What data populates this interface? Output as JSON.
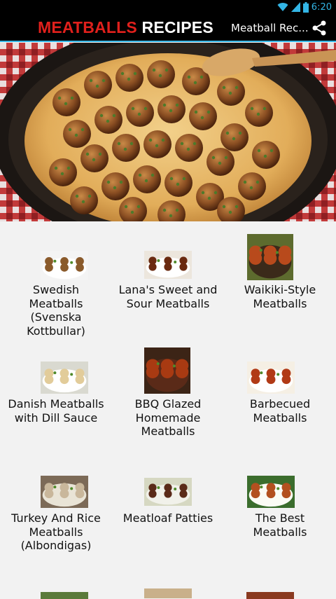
{
  "status_bar": {
    "time": "6:20",
    "icons": [
      "wifi-icon",
      "signal-icon",
      "battery-icon"
    ]
  },
  "action_bar": {
    "logo_word1": "MEATBALLS",
    "logo_word2": "RECIPES",
    "spinner_title": "Meatball Rec...",
    "share_icon": "share-icon"
  },
  "colors": {
    "accent": "#33b5e5",
    "logo_red": "#e0201c",
    "background": "#f2f2f2"
  },
  "recipes": [
    {
      "title": "Swedish Meatballs (Svenska Kottbullar)"
    },
    {
      "title": "Lana's Sweet and Sour Meatballs"
    },
    {
      "title": "Waikiki-Style Meatballs"
    },
    {
      "title": "Danish Meatballs with Dill Sauce"
    },
    {
      "title": "BBQ Glazed Homemade Meatballs"
    },
    {
      "title": "Barbecued Meatballs"
    },
    {
      "title": "Turkey And Rice Meatballs (Albondigas)"
    },
    {
      "title": "Meatloaf Patties"
    },
    {
      "title": "The Best Meatballs"
    }
  ]
}
